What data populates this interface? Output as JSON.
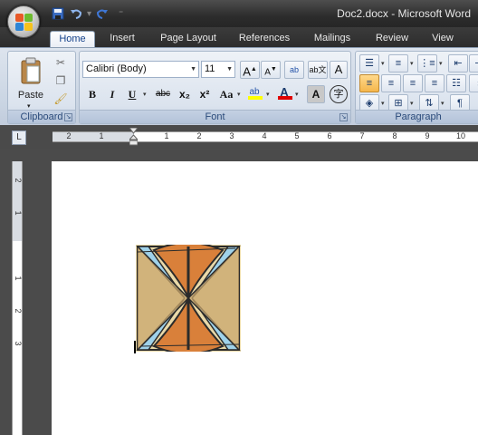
{
  "window": {
    "document_title": "Doc2.docx - Microsoft Word"
  },
  "quick_access": {
    "save_icon": "save-icon",
    "undo_icon": "undo-icon",
    "redo_icon": "redo-icon",
    "customize_icon": "customize-qat-icon"
  },
  "tabs": [
    {
      "label": "Home",
      "active": true
    },
    {
      "label": "Insert"
    },
    {
      "label": "Page Layout"
    },
    {
      "label": "References"
    },
    {
      "label": "Mailings"
    },
    {
      "label": "Review"
    },
    {
      "label": "View"
    }
  ],
  "clipboard": {
    "paste_label": "Paste",
    "group_label": "Clipboard"
  },
  "font": {
    "font_name": "Calibri (Body)",
    "font_size": "11",
    "grow_label": "A",
    "shrink_label": "A",
    "bold_label": "B",
    "italic_label": "I",
    "underline_label": "U",
    "strike_label": "abc",
    "subscript_label": "x₂",
    "superscript_label": "x²",
    "case_label": "Aa",
    "highlight_label": "ab",
    "font_color_label": "A",
    "char_shading_label": "A",
    "enclose_label": "字",
    "highlight_color": "#ffff00",
    "font_color": "#e00000",
    "group_label": "Font"
  },
  "paragraph": {
    "group_label": "Paragraph"
  },
  "ruler": {
    "h_numbers": [
      "2",
      "1",
      "1",
      "2",
      "3",
      "4",
      "5",
      "6",
      "7",
      "8",
      "9",
      "10"
    ],
    "v_numbers": [
      "2",
      "1",
      "1",
      "2",
      "3"
    ]
  }
}
